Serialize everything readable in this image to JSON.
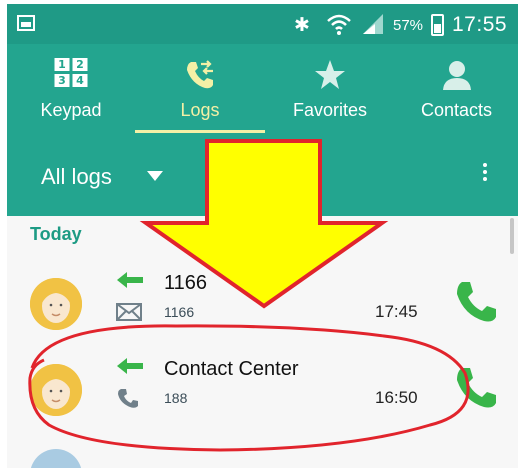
{
  "status": {
    "battery": "57%",
    "time": "17:55",
    "icons": [
      "gallery-icon",
      "bluetooth-icon",
      "wifi-icon",
      "signal-icon",
      "battery-icon"
    ]
  },
  "tabs": [
    {
      "label": "Keypad",
      "icon": "keypad-icon",
      "active": false
    },
    {
      "label": "Logs",
      "icon": "logs-icon",
      "active": true
    },
    {
      "label": "Favorites",
      "icon": "star-icon",
      "active": false
    },
    {
      "label": "Contacts",
      "icon": "person-icon",
      "active": false
    }
  ],
  "filter": {
    "label": "All logs",
    "icons": [
      "dropdown-caret-icon",
      "overflow-menu-icon"
    ]
  },
  "logs": {
    "section": "Today",
    "rows": [
      {
        "title": "1166",
        "number": "1166",
        "time": "17:45",
        "direction_icon": "outgoing-arrow-icon",
        "type_icon": "message-icon",
        "call_icon": "call-icon"
      },
      {
        "title": "Contact Center",
        "number": "188",
        "time": "16:50",
        "direction_icon": "outgoing-arrow-icon",
        "type_icon": "phone-icon",
        "call_icon": "call-icon"
      }
    ]
  },
  "colors": {
    "status_bar": "#1f9a86",
    "header": "#23a58f",
    "active_tab": "#f3f0a6",
    "arrow_fill": "#ffff00",
    "annotation": "#e1242c",
    "call_green": "#39b54a"
  }
}
